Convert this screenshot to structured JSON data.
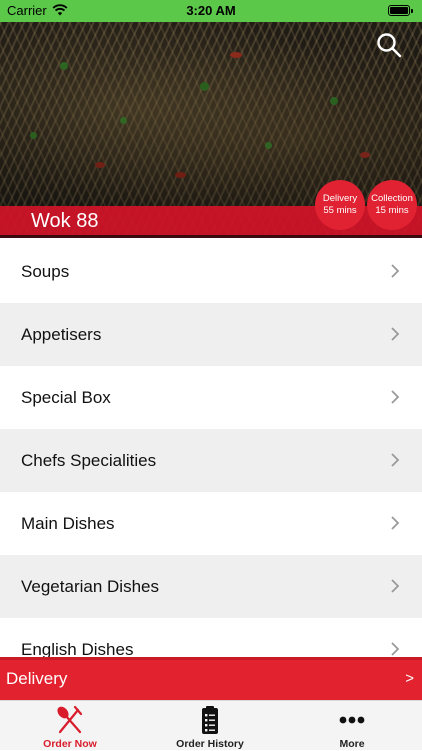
{
  "status": {
    "carrier": "Carrier",
    "time": "3:20 AM"
  },
  "restaurant": {
    "name": "Wok 88"
  },
  "badges": {
    "delivery": {
      "label": "Delivery",
      "time": "55 mins"
    },
    "collection": {
      "label": "Collection",
      "time": "15 mins"
    }
  },
  "menu": {
    "categories": [
      "Soups",
      "Appetisers",
      "Special Box",
      "Chefs Specialities",
      "Main Dishes",
      "Vegetarian Dishes",
      "English Dishes"
    ]
  },
  "delivery_bar": {
    "label": "Delivery",
    "arrow": ">"
  },
  "tabs": [
    {
      "label": "Order Now",
      "icon": "fork-knife-icon"
    },
    {
      "label": "Order History",
      "icon": "clipboard-icon"
    },
    {
      "label": "More",
      "icon": "more-dots-icon"
    }
  ],
  "colors": {
    "accent": "#e2222f",
    "status_bar": "#5cc84a"
  }
}
